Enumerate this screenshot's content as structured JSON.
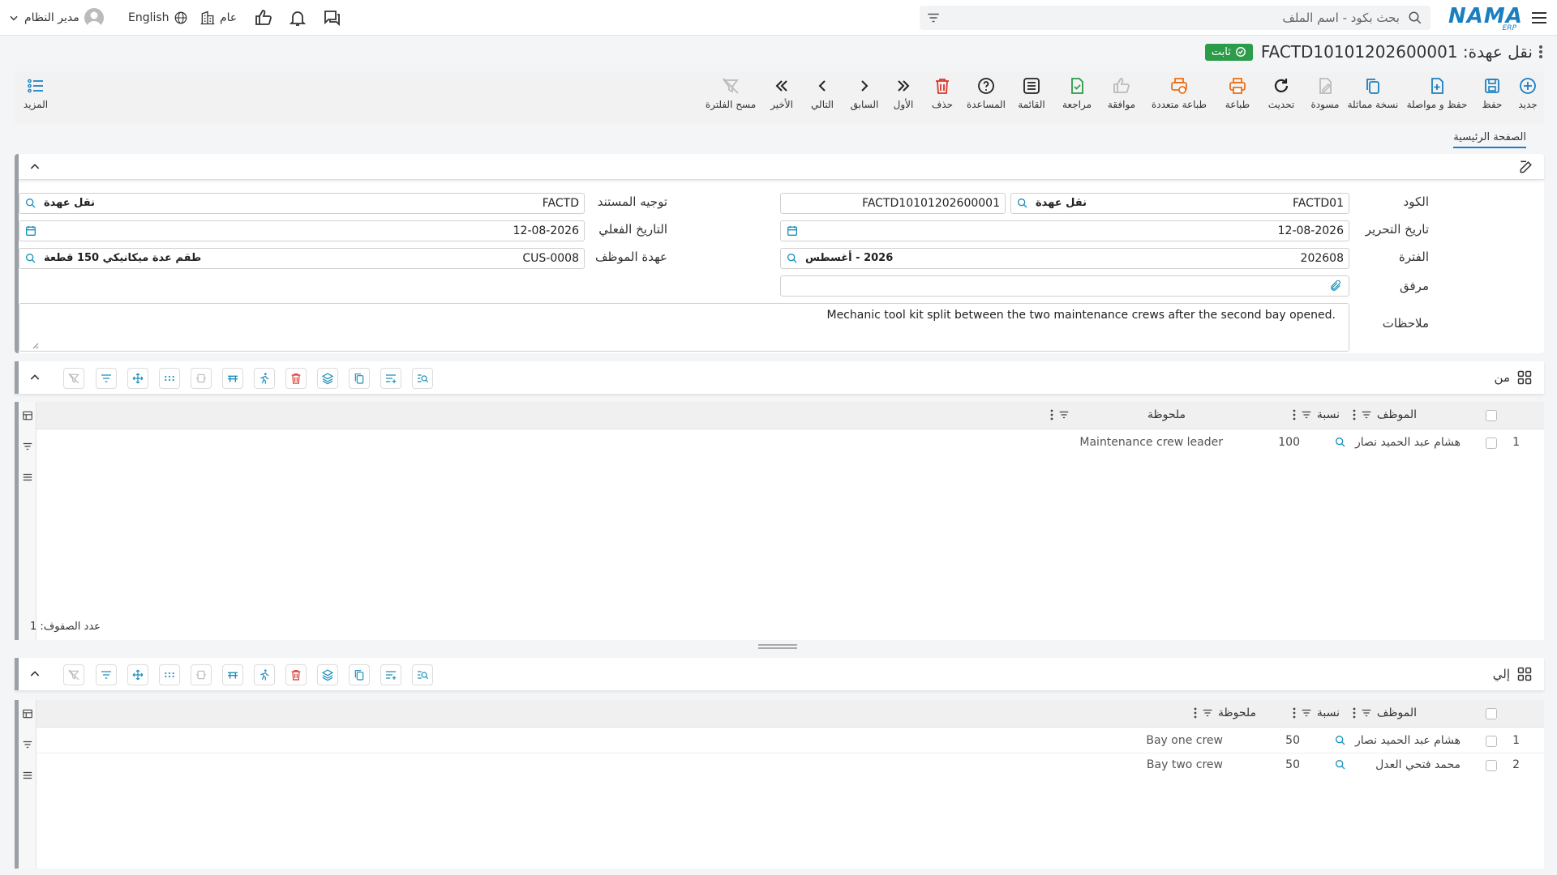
{
  "topbar": {
    "search_placeholder": "بحث بكود - اسم الملف",
    "logo_text": "NAMA",
    "logo_sub": "ERP",
    "language": "English",
    "context": "عام",
    "user_name": "مدير النظام"
  },
  "page": {
    "title": "نقل عهدة: FACTD10101202600001",
    "status": "ثابت"
  },
  "toolbar": {
    "new": "جديد",
    "save": "حفظ",
    "save_continue": "حفظ و مواصلة",
    "duplicate": "نسخة مماثلة",
    "draft": "مسودة",
    "refresh": "تحديث",
    "print": "طباعة",
    "multi_print": "طباعة متعددة",
    "approve": "موافقة",
    "review": "مراجعة",
    "list": "القائمة",
    "help": "المساعدة",
    "delete": "حذف",
    "first": "الأول",
    "previous": "السابق",
    "next": "التالي",
    "last": "الأخير",
    "clear_filter": "مسح الفلترة",
    "more": "المزيد"
  },
  "tabs": {
    "main": "الصفحة الرئيسية"
  },
  "form": {
    "code_label": "الكود",
    "code_value": "FACTD01",
    "code_tag": "نقل عهدة",
    "code_number": "FACTD10101202600001",
    "doc_direction_label": "توجيه المستند",
    "doc_direction_value": "FACTD",
    "doc_direction_tag": "نقل عهدة",
    "edit_date_label": "تاريخ التحرير",
    "edit_date_value": "12-08-2026",
    "actual_date_label": "التاريخ الفعلي",
    "actual_date_value": "12-08-2026",
    "period_label": "الفترة",
    "period_value": "202608",
    "period_tag": "2026 - أغسطس",
    "employee_custody_label": "عهدة الموظف",
    "employee_custody_value": "CUS-0008",
    "employee_custody_tag": "طقم عدة ميكانيكي 150 قطعة",
    "attachment_label": "مرفق",
    "notes_label": "ملاحظات",
    "notes_value": "Mechanic tool kit split between the two maintenance crews after the second bay opened."
  },
  "from_grid": {
    "title": "من",
    "col_employee": "الموظف",
    "col_ratio": "نسبة",
    "col_note": "ملحوظة",
    "rows": [
      {
        "n": "1",
        "employee": "هشام عبد الحميد نصار",
        "ratio": "100",
        "note": "Maintenance crew leader"
      }
    ],
    "row_count_label": "عدد الصفوف:",
    "row_count": "1"
  },
  "to_grid": {
    "title": "إلي",
    "col_employee": "الموظف",
    "col_ratio": "نسبة",
    "col_note": "ملحوظة",
    "rows": [
      {
        "n": "1",
        "employee": "هشام عبد الحميد نصار",
        "ratio": "50",
        "note": "Bay one crew"
      },
      {
        "n": "2",
        "employee": "محمد فتحي العدل",
        "ratio": "50",
        "note": "Bay two crew"
      }
    ]
  },
  "colors": {
    "accent": "#1a7fc1",
    "success": "#2c9c4a",
    "danger": "#d9342b",
    "orange": "#e8711c",
    "grid_icon": "#1a8fb8"
  }
}
